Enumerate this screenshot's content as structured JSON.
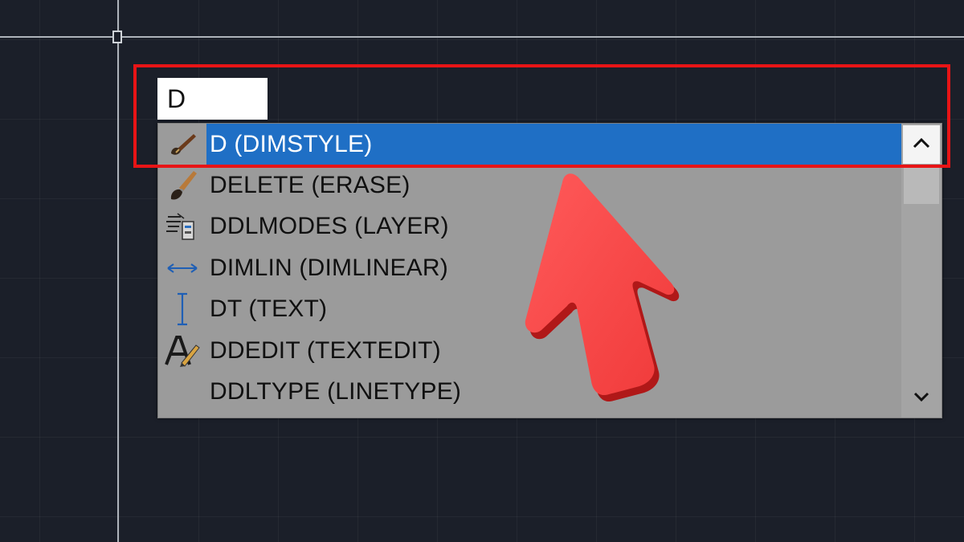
{
  "command_line": {
    "input_value": "D"
  },
  "autocomplete": {
    "items": [
      {
        "label": "D (DIMSTYLE)",
        "icon": "dimstyle-brush-icon",
        "selected": true
      },
      {
        "label": "DELETE (ERASE)",
        "icon": "eraser-brush-icon",
        "selected": false
      },
      {
        "label": "DDLMODES (LAYER)",
        "icon": "layer-properties-icon",
        "selected": false
      },
      {
        "label": "DIMLIN (DIMLINEAR)",
        "icon": "linear-dimension-icon",
        "selected": false
      },
      {
        "label": "DT (TEXT)",
        "icon": "text-cursor-icon",
        "selected": false
      },
      {
        "label": "DDEDIT (TEXTEDIT)",
        "icon": "text-edit-icon",
        "selected": false
      },
      {
        "label": "DDLTYPE (LINETYPE)",
        "icon": "",
        "selected": false
      }
    ]
  },
  "colors": {
    "canvas_background": "#1b1f29",
    "selection": "#1f6fc5",
    "list_background": "#9b9b9b",
    "annotation_red": "#e81416"
  }
}
